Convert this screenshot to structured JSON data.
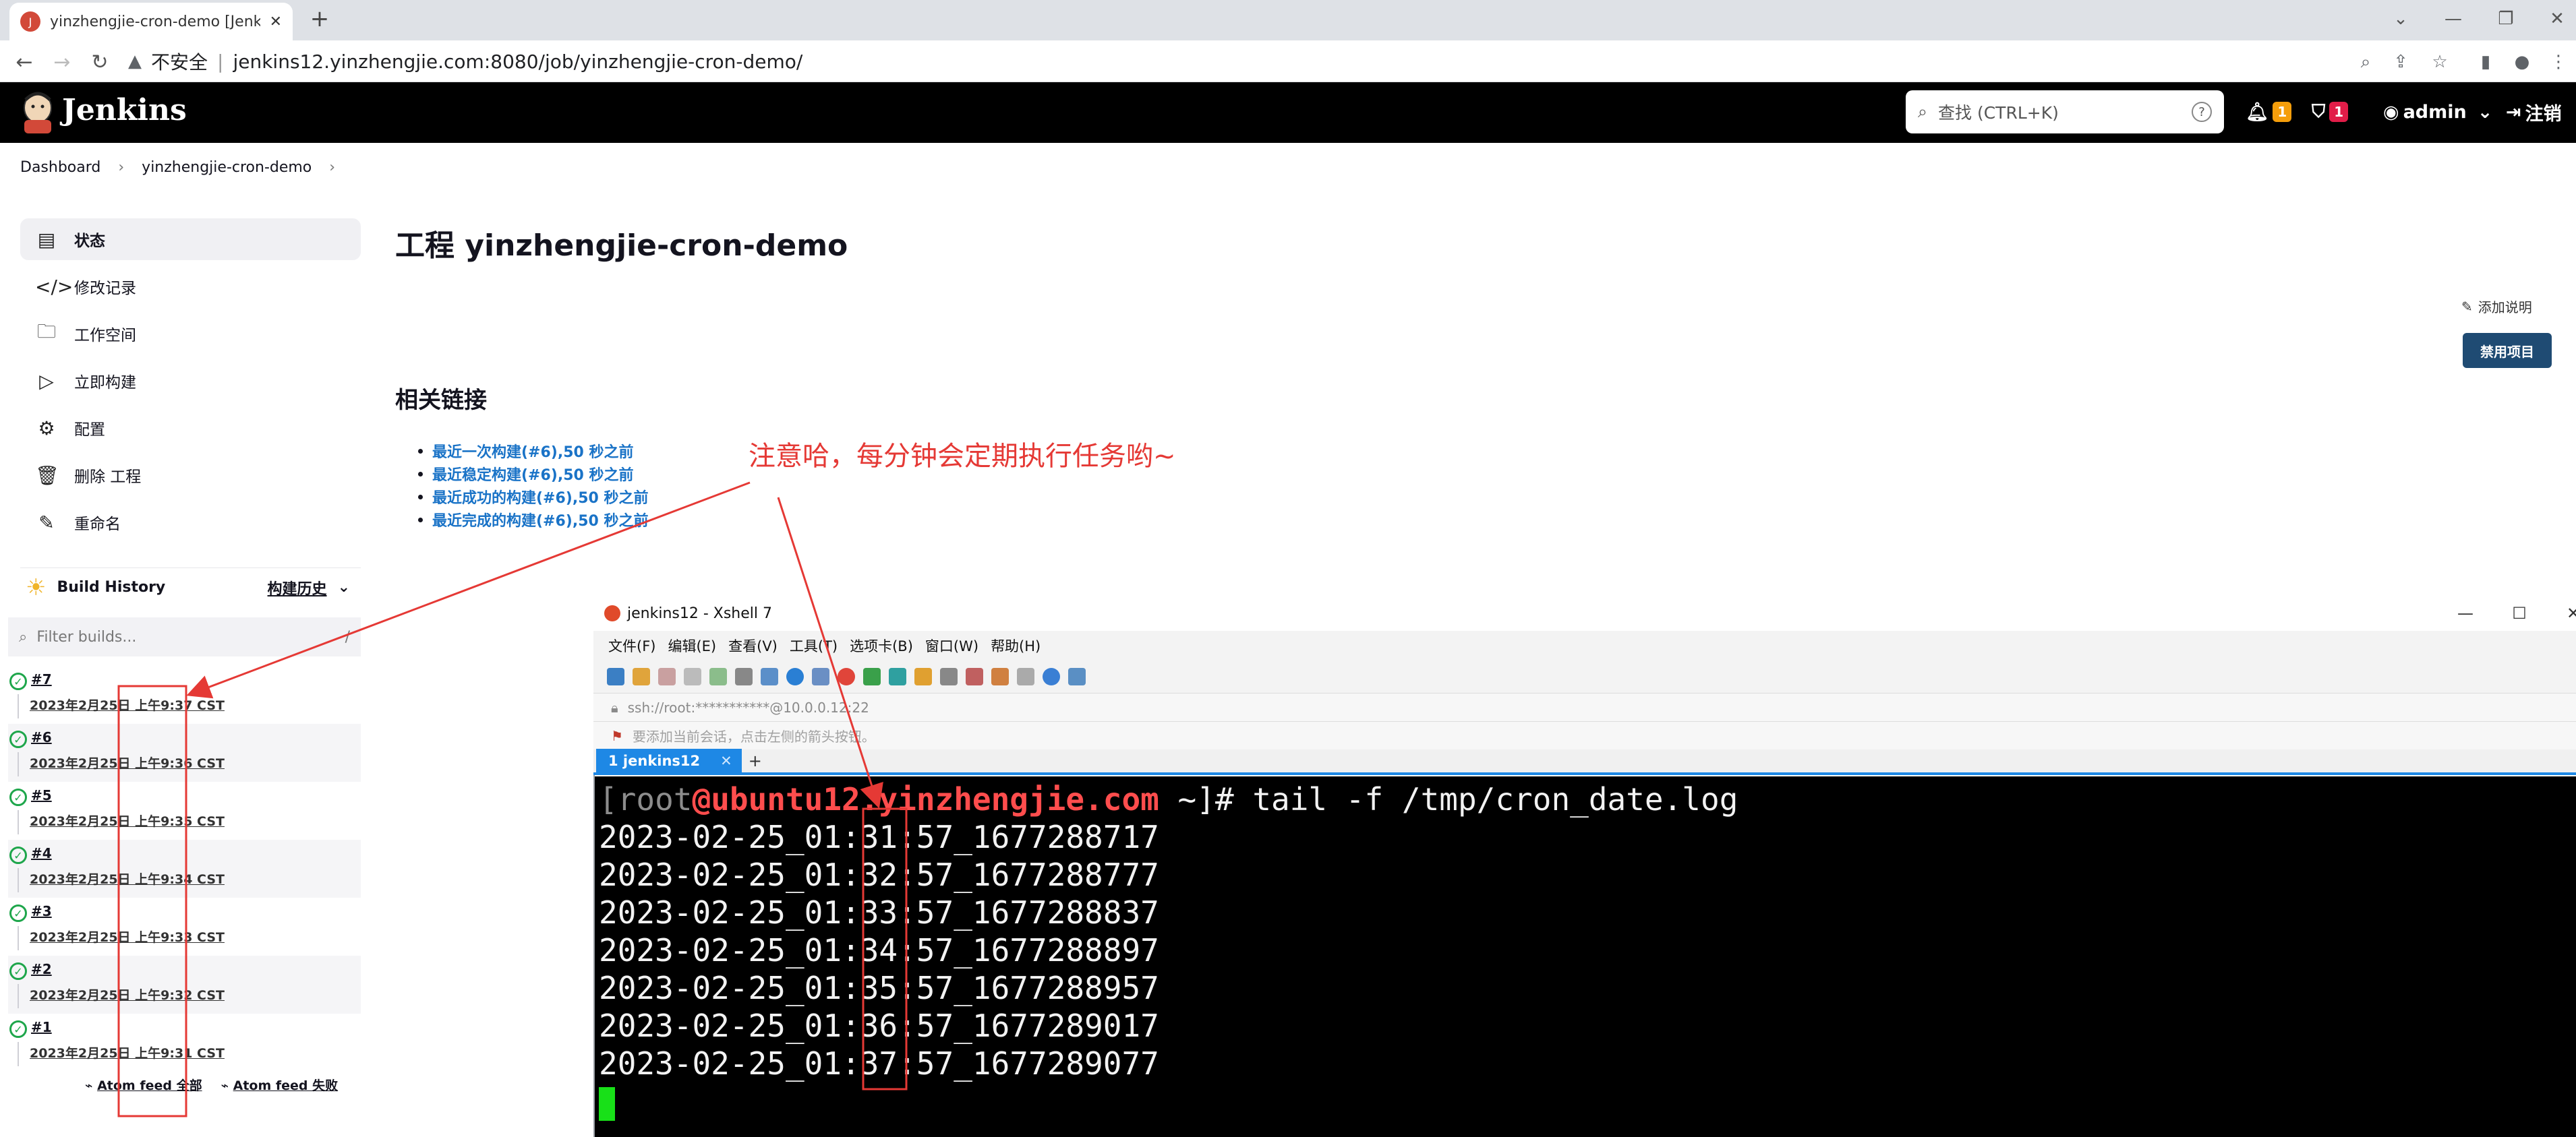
{
  "browser": {
    "tab_title": "yinzhengjie-cron-demo [Jenkins]",
    "new_tab": "+",
    "insecure_label": "不安全",
    "url": "jenkins12.yinzhengjie.com:8080/job/yinzhengjie-cron-demo/"
  },
  "header": {
    "app_name": "Jenkins",
    "search_placeholder": "查找 (CTRL+K)",
    "notifications_count": "1",
    "security_count": "1",
    "user": "admin",
    "logout": "注销"
  },
  "breadcrumb": [
    "Dashboard",
    "yinzhengjie-cron-demo"
  ],
  "sidebar": {
    "items": [
      {
        "label": "状态",
        "icon": "status-icon"
      },
      {
        "label": "修改记录",
        "icon": "code-icon"
      },
      {
        "label": "工作空间",
        "icon": "folder-icon"
      },
      {
        "label": "立即构建",
        "icon": "play-icon"
      },
      {
        "label": "配置",
        "icon": "gear-icon"
      },
      {
        "label": "删除 工程",
        "icon": "trash-icon"
      },
      {
        "label": "重命名",
        "icon": "pencil-icon"
      }
    ]
  },
  "build_history": {
    "title": "Build History",
    "trend": "构建历史",
    "filter_placeholder": "Filter builds...",
    "filter_shortcut": "/",
    "builds": [
      {
        "num": "#7",
        "time": "2023年2月25日 上午9:37 CST"
      },
      {
        "num": "#6",
        "time": "2023年2月25日 上午9:36 CST"
      },
      {
        "num": "#5",
        "time": "2023年2月25日 上午9:35 CST"
      },
      {
        "num": "#4",
        "time": "2023年2月25日 上午9:34 CST"
      },
      {
        "num": "#3",
        "time": "2023年2月25日 上午9:33 CST"
      },
      {
        "num": "#2",
        "time": "2023年2月25日 上午9:32 CST"
      },
      {
        "num": "#1",
        "time": "2023年2月25日 上午9:31 CST"
      }
    ],
    "feed_all": "Atom feed 全部",
    "feed_failed": "Atom feed 失败"
  },
  "main": {
    "title": "工程 yinzhengjie-cron-demo",
    "add_description": "添加说明",
    "disable_button": "禁用项目",
    "links_title": "相关链接",
    "links": [
      "最近一次构建(#6),50 秒之前",
      "最近稳定构建(#6),50 秒之前",
      "最近成功的构建(#6),50 秒之前",
      "最近完成的构建(#6),50 秒之前"
    ]
  },
  "annotation": "注意哈，每分钟会定期执行任务哟~",
  "xshell": {
    "title": "jenkins12 - Xshell 7",
    "menu": [
      "文件(F)",
      "编辑(E)",
      "查看(V)",
      "工具(T)",
      "选项卡(B)",
      "窗口(W)",
      "帮助(H)"
    ],
    "address": "ssh://root:***********@10.0.0.12:22",
    "hint": "要添加当前会话，点击左侧的箭头按钮。",
    "tab": "1 jenkins12",
    "prompt_user": "root",
    "prompt_host": "ubuntu12.yinzhengjie.com",
    "prompt_rest": " ~]# tail -f /tmp/cron_date.log",
    "lines": [
      "2023-02-25_01:31:57_1677288717",
      "2023-02-25_01:32:57_1677288777",
      "2023-02-25_01:33:57_1677288837",
      "2023-02-25_01:34:57_1677288897",
      "2023-02-25_01:35:57_1677288957",
      "2023-02-25_01:36:57_1677289017",
      "2023-02-25_01:37:57_1677289077"
    ]
  },
  "colors": {
    "accent": "#1f4b73",
    "link": "#1a73c7",
    "annotation": "#e53935",
    "success": "#1ea64b"
  }
}
